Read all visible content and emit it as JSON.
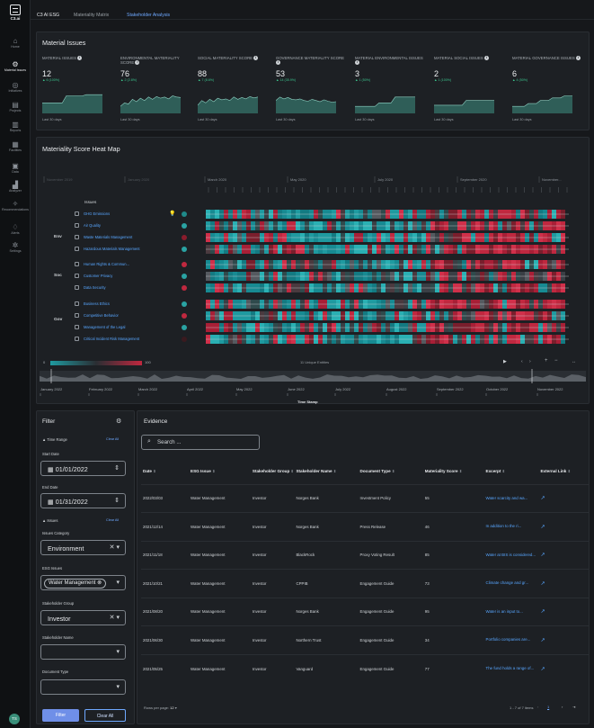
{
  "app": {
    "logo_text": "C3.ai",
    "avatar": "TS"
  },
  "nav": [
    {
      "icon": "home-icon",
      "glyph": "⌂",
      "label": "Home"
    },
    {
      "icon": "gear-badge-icon",
      "glyph": "⚙",
      "label": "Material Issues"
    },
    {
      "icon": "target-icon",
      "glyph": "◎",
      "label": "Initiatives"
    },
    {
      "icon": "clipboard-icon",
      "glyph": "▤",
      "label": "Projects"
    },
    {
      "icon": "document-icon",
      "glyph": "▥",
      "label": "Reports"
    },
    {
      "icon": "building-icon",
      "glyph": "▦",
      "label": "Facilities"
    },
    {
      "icon": "database-icon",
      "glyph": "▣",
      "label": "Data"
    },
    {
      "icon": "analyzer-icon",
      "glyph": "▟",
      "label": "Analyzer"
    },
    {
      "icon": "lightbulb-icon",
      "glyph": "✧",
      "label": "Recommendations"
    },
    {
      "icon": "bell-icon",
      "glyph": "♢",
      "label": "Alerts"
    },
    {
      "icon": "settings-icon",
      "glyph": "✲",
      "label": "Settings"
    }
  ],
  "tabs": [
    "C3 AI ESG",
    "Materiality Matrix",
    "Stakeholder Analysis"
  ],
  "material_issues": {
    "title": "Material Issues",
    "metrics": [
      {
        "title": "MATERIAL ISSUES",
        "value": "12",
        "delta": "▲ 6 (100%)",
        "period": "Last 30 days",
        "trend": [
          0.45,
          0.45,
          0.45,
          0.45,
          0.45,
          0.45,
          0.75,
          0.75,
          0.75,
          0.75,
          0.75,
          0.8,
          0.8,
          0.8,
          0.8,
          0.8
        ]
      },
      {
        "title": "ENVIRONMENTAL MATERIALITY SCORE",
        "value": "76",
        "delta": "▲ 2 (2.8%)",
        "period": "Last 30 days",
        "trend": [
          0.3,
          0.45,
          0.4,
          0.6,
          0.5,
          0.65,
          0.55,
          0.7,
          0.6,
          0.72,
          0.65,
          0.7,
          0.62,
          0.75,
          0.7,
          0.68
        ]
      },
      {
        "title": "SOCIAL MATERIALITY SCORE",
        "value": "88",
        "delta": "▲ 7 (8.6%)",
        "period": "Last 30 days",
        "trend": [
          0.35,
          0.55,
          0.45,
          0.6,
          0.5,
          0.65,
          0.58,
          0.62,
          0.55,
          0.7,
          0.6,
          0.68,
          0.62,
          0.72,
          0.66,
          0.7
        ]
      },
      {
        "title": "GOVERNANCE MATERIALITY SCORE",
        "value": "53",
        "delta": "▲ 14 (35.9%)",
        "period": "Last 30 days",
        "trend": [
          0.55,
          0.7,
          0.62,
          0.68,
          0.6,
          0.58,
          0.62,
          0.55,
          0.52,
          0.6,
          0.55,
          0.5,
          0.58,
          0.52,
          0.48,
          0.5
        ]
      },
      {
        "title": "MATERIAL ENVIRONMENTAL ISSUES",
        "value": "3",
        "delta": "▲ 1 (50%)",
        "period": "Last 30 days",
        "trend": [
          0.3,
          0.3,
          0.3,
          0.3,
          0.3,
          0.3,
          0.45,
          0.45,
          0.45,
          0.45,
          0.7,
          0.7,
          0.7,
          0.7,
          0.7,
          0.7
        ]
      },
      {
        "title": "MATERIAL SOCIAL ISSUES",
        "value": "2",
        "delta": "▲ 1 (100%)",
        "period": "Last 30 days",
        "trend": [
          0.35,
          0.35,
          0.35,
          0.35,
          0.35,
          0.35,
          0.35,
          0.35,
          0.55,
          0.55,
          0.55,
          0.55,
          0.55,
          0.55,
          0.55,
          0.55
        ]
      },
      {
        "title": "MATERIAL GOVERNANCE ISSUES",
        "value": "6",
        "delta": "▲ 4 (50%)",
        "period": "Last 30 days",
        "trend": [
          0.3,
          0.3,
          0.3,
          0.3,
          0.42,
          0.42,
          0.42,
          0.55,
          0.55,
          0.55,
          0.66,
          0.66,
          0.66,
          0.75,
          0.75,
          0.75
        ]
      }
    ]
  },
  "heatmap": {
    "title": "Materiality Score Heat Map",
    "issues_label": "Issues",
    "months_top": [
      "November 2019",
      "January 2020",
      "March 2020",
      "May 2020",
      "July 2020",
      "September 2020",
      "November..."
    ],
    "groups": [
      {
        "name": "Env",
        "issues": [
          {
            "name": "GHG Emissions",
            "status": "#1f8a8a",
            "flag": true
          },
          {
            "name": "Air Quality",
            "status": "#2aa3a3"
          },
          {
            "name": "Waste Materials Management",
            "status": "#8a1c2c"
          },
          {
            "name": "Hazardous Materials Management",
            "status": "#2aa3a3"
          }
        ]
      },
      {
        "name": "Soc",
        "issues": [
          {
            "name": "Human Rights & Commun...",
            "status": "#c0283f"
          },
          {
            "name": "Customer Privacy",
            "status": "#2aa3a3"
          },
          {
            "name": "Data Security",
            "status": "#c0283f"
          }
        ]
      },
      {
        "name": "Gov",
        "issues": [
          {
            "name": "Business Ethics",
            "status": "#2aa3a3"
          },
          {
            "name": "Competitive Behavior",
            "status": "#c0283f"
          },
          {
            "name": "Management of the Legal",
            "status": "#2aa3a3"
          },
          {
            "name": "Critical Incident Risk Management",
            "status": "#3a1a1f"
          }
        ]
      }
    ],
    "scale_min": "0",
    "scale_max": "100",
    "unique_entities": "11 Unique Entities",
    "controls": {
      "play": "▶",
      "prev": "‹",
      "next": "›",
      "zoom_in": "+",
      "zoom_out": "−",
      "expand": "↔"
    },
    "months_bottom": [
      "January 2022",
      "February 2022",
      "March 2022",
      "April 2022",
      "May 2022",
      "June 2022",
      "July 2022",
      "August 2022",
      "September 2022",
      "October 2022",
      "November 2022"
    ],
    "axis_title": "Time Stamp"
  },
  "filter": {
    "title": "Filter",
    "time_range": "Time Range",
    "clear_all": "Clear All",
    "start_label": "Start Date",
    "start_value": "01/01/2022",
    "end_label": "End Date",
    "end_value": "01/31/2022",
    "issues": "Issues",
    "category_label": "Issues Category",
    "category_value": "Environment",
    "esg_label": "ESG Issues",
    "esg_value": "Water Management",
    "group_label": "Stakeholder Group",
    "group_value": "Investor",
    "name_label": "Stakeholder Name",
    "doc_label": "Document Type",
    "filter_btn": "Filter",
    "clear_btn": "Clear All"
  },
  "evidence": {
    "title": "Evidence",
    "search_placeholder": "Search ...",
    "columns": [
      "Date",
      "ESG Issue",
      "Stakeholder Group",
      "Stakeholder Name",
      "Document Type",
      "Materiality Score",
      "Excerpt",
      "External Link"
    ],
    "rows": [
      [
        "2022/03/03",
        "Water Management",
        "Investor",
        "Norges Bank",
        "Investment Policy",
        "55",
        "Water scarcity and wa..."
      ],
      [
        "2021/12/14",
        "Water Management",
        "Investor",
        "Norges Bank",
        "Press Release",
        "46",
        "In addition to the ri..."
      ],
      [
        "2021/11/18",
        "Water Management",
        "Investor",
        "BlackRock",
        "Proxy Voting Result",
        "85",
        "Water at BIS is considered..."
      ],
      [
        "2021/10/21",
        "Water Management",
        "Investor",
        "CPPIB",
        "Engagement Guide",
        "73",
        "Climate change and gr..."
      ],
      [
        "2021/08/20",
        "Water Management",
        "Investor",
        "Norges Bank",
        "Engagement Guide",
        "95",
        "Water is an input to..."
      ],
      [
        "2021/06/30",
        "Water Management",
        "Investor",
        "Northern Trust",
        "Engagement Guide",
        "34",
        "Portfolio companies are..."
      ],
      [
        "2021/05/25",
        "Water Management",
        "Investor",
        "Vanguard",
        "Engagement Guide",
        "77",
        "The fund holds a range of..."
      ]
    ],
    "rows_per_page_label": "Rows per page:",
    "rows_per_page": "12",
    "pagination": "1 - 7 of 7 items",
    "page": "1"
  },
  "colors": {
    "teal": "#1f9aa0",
    "red": "#c0283f",
    "dark": "#3a2a2e",
    "accent": "#6ea8ff",
    "positive": "#3bc48d"
  }
}
